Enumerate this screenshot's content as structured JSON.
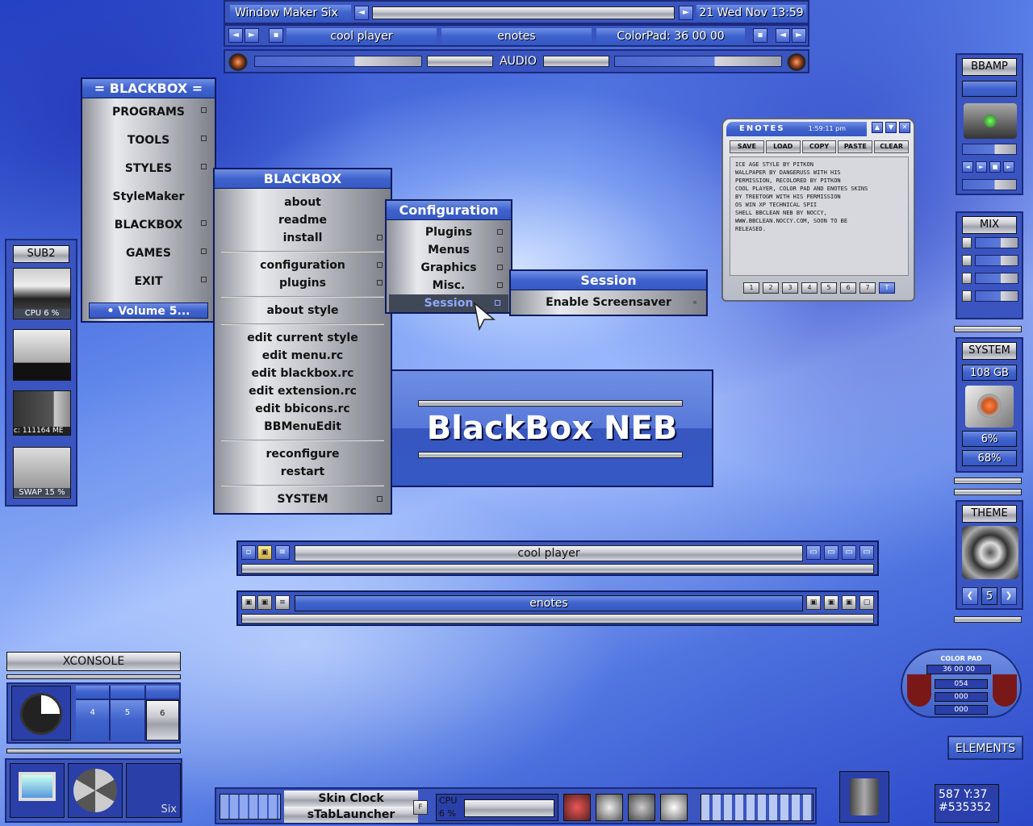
{
  "toolbar": {
    "title": "Window Maker Six",
    "clock": "21 Wed Nov 13:59",
    "left_arrow": "◄",
    "right_arrow": "►"
  },
  "taskbar": {
    "tasks": [
      "cool player",
      "enotes",
      "ColorPad: 36 00 00"
    ]
  },
  "audio": {
    "label": "AUDIO"
  },
  "blackbox_menu": {
    "title": "= BLACKBOX =",
    "items": [
      "PROGRAMS",
      "TOOLS",
      "STYLES",
      "StyleMaker",
      "BLACKBOX",
      "GAMES",
      "EXIT"
    ],
    "volume": "• Volume 5..."
  },
  "bb_submenu": {
    "title": "BLACKBOX",
    "group1": [
      "about",
      "readme",
      "install"
    ],
    "group2": [
      "configuration",
      "plugins"
    ],
    "group3": [
      "about style"
    ],
    "group4": [
      "edit current style",
      "edit menu.rc",
      "edit blackbox.rc",
      "edit extension.rc",
      "edit bbicons.rc",
      "BBMenuEdit"
    ],
    "group5": [
      "reconfigure",
      "restart"
    ],
    "group6": [
      "SYSTEM"
    ]
  },
  "config_menu": {
    "title": "Configuration",
    "items": [
      "Plugins",
      "Menus",
      "Graphics",
      "Misc.",
      "Session"
    ]
  },
  "session_menu": {
    "title": "Session",
    "items": [
      "Enable Screensaver"
    ]
  },
  "banner": {
    "text": "BlackBox NEB"
  },
  "enotes": {
    "title": "ENOTES",
    "time": "1:59:11 pm",
    "buttons": [
      "SAVE",
      "LOAD",
      "COPY",
      "PASTE",
      "CLEAR"
    ],
    "lines": [
      "ICE AGE STYLE BY PITKON",
      "WALLPAPER BY DANGERUSS WITH HIS",
      "PERMISSION, RECOLORED BY PITKON",
      "COOL PLAYER, COLOR PAD AND ENOTES SKINS",
      "BY TREETOGM WITH HIS PERMISSION",
      "OS WIN XP TECHNICAL SPII",
      "SHELL BBCLEAN NEB BY NOCCY,",
      "WWW.BBCLEAN.NOCCY.COM, SOON TO BE",
      "RELEASED."
    ],
    "tabs": [
      "1",
      "2",
      "3",
      "4",
      "5",
      "6",
      "7",
      "T"
    ]
  },
  "left_panel": {
    "title": "SUB2",
    "cpu": "CPU 6 %",
    "mem": "c: 111164 ME",
    "swap": "SWAP 15 %"
  },
  "right_panel": {
    "bbamp": "BBAMP",
    "mix": "MIX",
    "system": "SYSTEM",
    "disk": "108 GB",
    "p1": "6%",
    "p2": "68%",
    "theme": "THEME",
    "theme_num": "5",
    "elements": "ELEMENTS"
  },
  "apps": {
    "cool_player": "cool player",
    "enotes": "enotes"
  },
  "xconsole": {
    "title": "XCONSOLE",
    "desks": [
      "4",
      "5",
      "6"
    ]
  },
  "bottom_left": {
    "label": "Six"
  },
  "bottom_bar": {
    "skin_clock": "Skin Clock",
    "stab": "sTabLauncher",
    "f": "F",
    "cpu": "CPU",
    "cpu_val": "6 %"
  },
  "colorpad": {
    "title": "COLOR PAD",
    "hex": "36 00 00",
    "r": "054",
    "g": "000",
    "b": "000"
  },
  "coords": {
    "xy": "587 Y:37",
    "hex": "#535352"
  },
  "colors": {
    "accent": "#3f62cc",
    "panel": "#3a55c0"
  }
}
